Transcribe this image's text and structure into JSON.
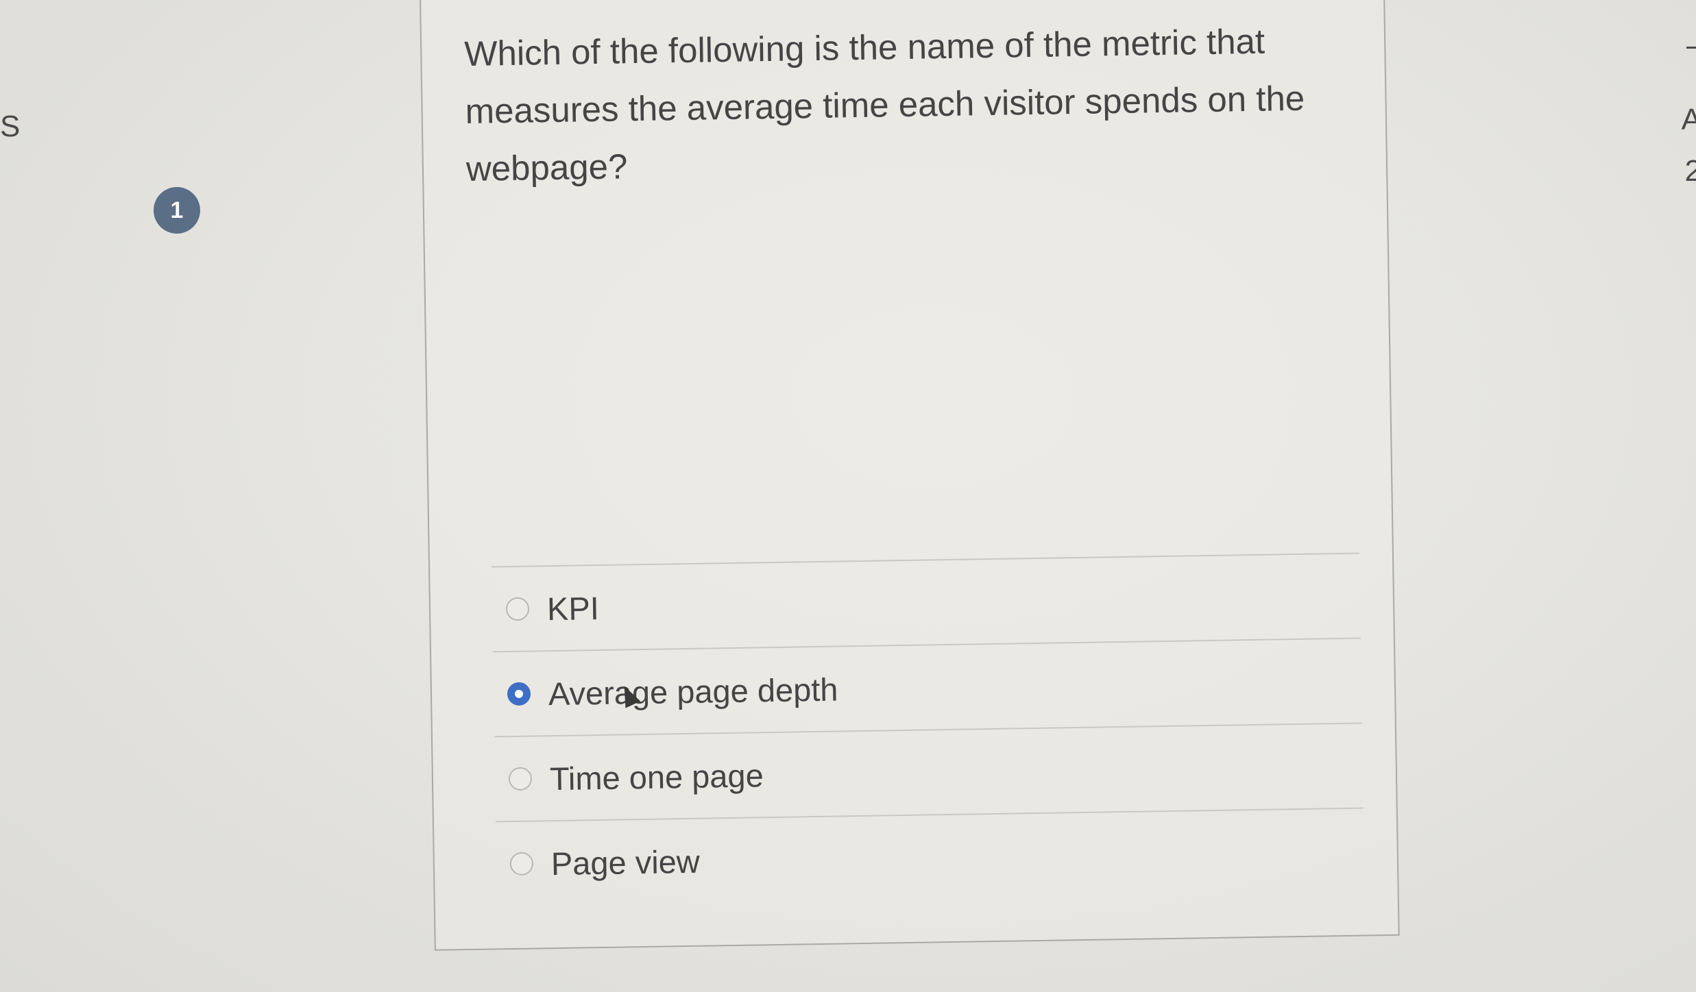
{
  "edge": {
    "left_text": "S",
    "right_text_1": "A",
    "right_text_2": "2"
  },
  "question": {
    "number": "1",
    "text": "Which of the following is the name of the metric that measures the average time each visitor spends on the webpage?"
  },
  "answers": [
    {
      "label": "KPI",
      "selected": false
    },
    {
      "label": "Average page depth",
      "selected": true
    },
    {
      "label": "Time one page",
      "selected": false
    },
    {
      "label": "Page view",
      "selected": false
    }
  ],
  "colors": {
    "badge": "#5a6e86",
    "radio_selected": "#3f6fc4",
    "background": "#e6e5df"
  }
}
